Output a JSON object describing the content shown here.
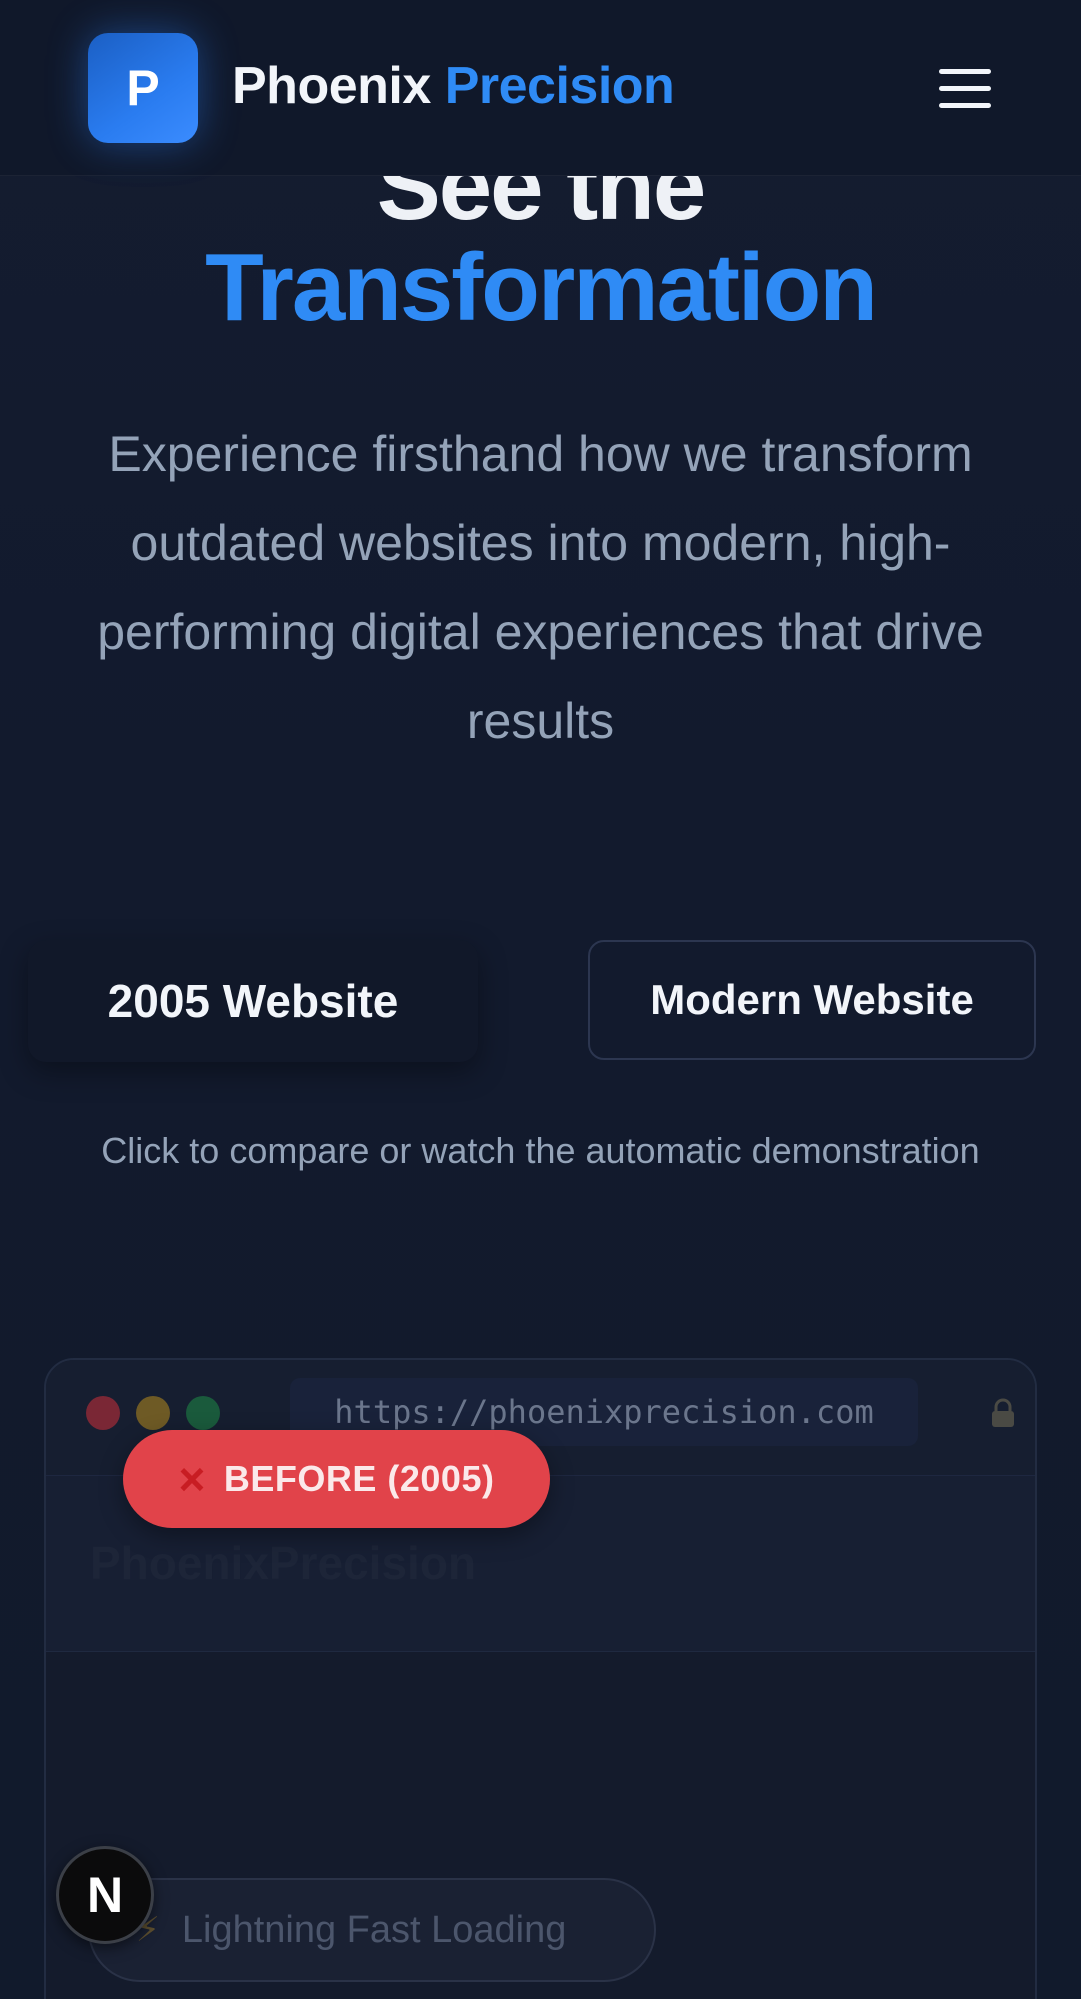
{
  "header": {
    "logo_letter": "P",
    "brand_word1": "Phoenix",
    "brand_word2": "Precision",
    "menu_icon": "hamburger-menu-icon"
  },
  "hero": {
    "title_line1": "See the",
    "title_line2": "Transformation",
    "description": "Experience firsthand how we transform outdated websites into modern, high-performing digital experiences that drive results"
  },
  "toggle": {
    "old_label": "2005 Website",
    "new_label": "Modern Website",
    "hint": "Click to compare or watch the automatic demonstration"
  },
  "browser": {
    "url": "https://phoenixprecision.com",
    "lock_icon": "lock-icon",
    "site_header_text": "PhoenixPrecision",
    "feature_pill_icon": "⚡",
    "feature_pill_text": "Lightning Fast Loading"
  },
  "badge": {
    "icon": "×",
    "label": "BEFORE (2005)"
  },
  "fab": {
    "letter": "N"
  },
  "colors": {
    "background": "#121a2e",
    "accent": "#2f8bf5",
    "badge_red": "#e1434a",
    "muted_text": "#94a3b8"
  }
}
